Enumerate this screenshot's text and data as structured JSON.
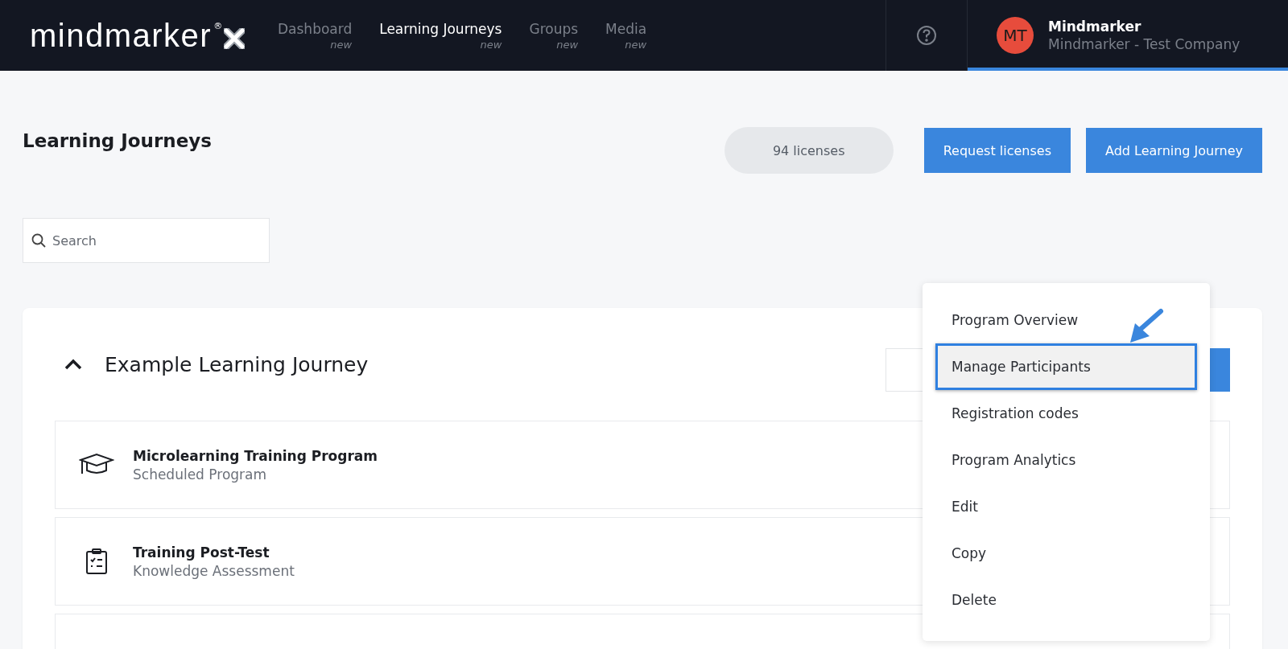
{
  "header": {
    "logo": {
      "text": "mindmarker",
      "mark": "®"
    },
    "nav": [
      {
        "label": "Dashboard",
        "badge": "new",
        "selected": false
      },
      {
        "label": "Learning Journeys",
        "badge": "new",
        "selected": true
      },
      {
        "label": "Groups",
        "badge": "new",
        "selected": false
      },
      {
        "label": "Media",
        "badge": "new",
        "selected": false
      }
    ],
    "user": {
      "initials": "MT",
      "name": "Mindmarker",
      "company": "Mindmarker - Test Company",
      "selected": true
    }
  },
  "page": {
    "title": "Learning Journeys",
    "licenses": "94 licenses",
    "buttons": [
      "Request licenses",
      "Add Learning Journey"
    ]
  },
  "search": {
    "placeholder": "Search"
  },
  "journey": {
    "title": "Example Learning Journey",
    "expanded": true,
    "items": [
      {
        "kind": "program",
        "title": "Microlearning Training Program",
        "subtitle": "Scheduled Program"
      },
      {
        "kind": "assessment",
        "title": "Training Post-Test",
        "subtitle": "Knowledge Assessment"
      },
      {
        "kind": "empty"
      }
    ]
  },
  "menu": [
    {
      "label": "Program Overview",
      "selected": false
    },
    {
      "label": "Manage Participants",
      "selected": true
    },
    {
      "label": "Registration codes",
      "selected": false
    },
    {
      "label": "Program Analytics",
      "selected": false
    },
    {
      "label": "Edit",
      "selected": false
    },
    {
      "label": "Copy",
      "selected": false
    },
    {
      "label": "Delete",
      "selected": false
    }
  ]
}
